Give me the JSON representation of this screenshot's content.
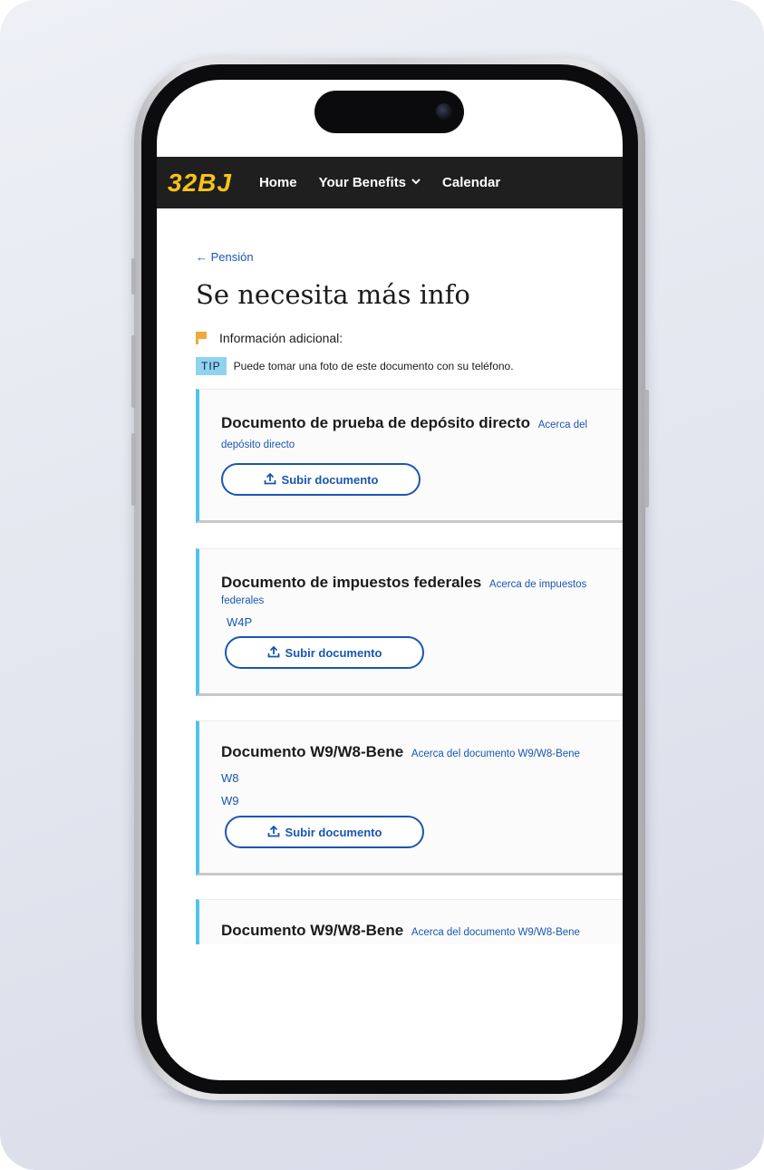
{
  "brand": {
    "logo": "32BJ",
    "logo_color": "#f5c31a",
    "nav_bg": "#1f1f1f"
  },
  "nav": {
    "home": "Home",
    "benefits": "Your Benefits",
    "calendar": "Calendar"
  },
  "page": {
    "back_link": "← Pensión",
    "title": "Se necesita más info",
    "info_label": "Información adicional:",
    "tip_badge": "TIP",
    "tip_text": "Puede tomar una foto de este documento con su teléfono."
  },
  "cards": [
    {
      "title": "Documento de prueba de depósito directo",
      "about_link_start": "Acerca del",
      "about_link_end": "depósito directo",
      "upload_label": "Subir documento"
    },
    {
      "title": "Documento de impuestos federales",
      "about_link_start": "Acerca de impuestos",
      "about_link_end": "federales",
      "documents": [
        "W4P"
      ],
      "upload_label": "Subir documento"
    },
    {
      "title": "Documento W9/W8-Bene",
      "about_link": "Acerca del documento W9/W8-Bene",
      "documents": [
        "W8",
        "W9"
      ],
      "upload_label": "Subir documento"
    },
    {
      "title": "Documento W9/W8-Bene",
      "about_link": "Acerca del documento W9/W8-Bene"
    }
  ],
  "colors": {
    "accent": "#1a56b0",
    "card_stripe": "#4fc3f0",
    "flag": "#f2a93b",
    "tip_badge": "#8fd3f1"
  }
}
